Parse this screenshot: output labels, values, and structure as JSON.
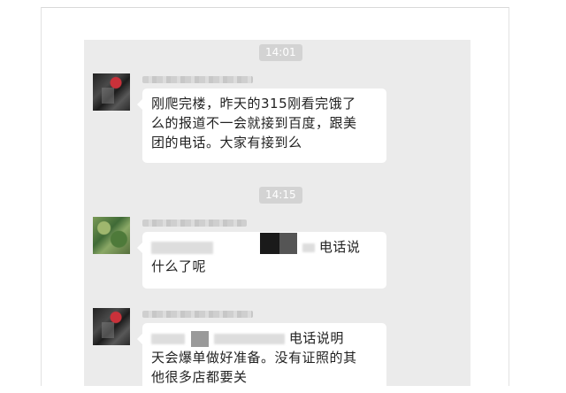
{
  "chat": {
    "timestamps": [
      "14:01",
      "14:15"
    ],
    "messages": [
      {
        "lines": [
          "刚爬完楼，昨天的315刚看完饿了",
          "么的报道不一会就接到百度，跟美",
          "团的电话。大家有接到么"
        ]
      },
      {
        "line1_visible": "电话说",
        "line2": "什么了呢"
      },
      {
        "line1_visible": "电话说明",
        "line2": "天会爆单做好准备。没有证照的其",
        "line3": "他很多店都要关"
      }
    ]
  }
}
